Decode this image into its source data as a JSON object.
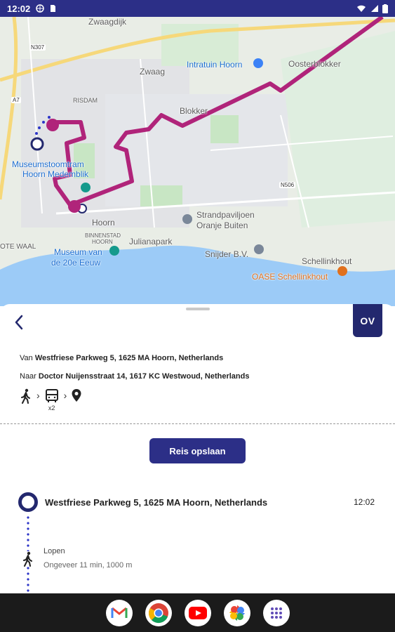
{
  "status_bar": {
    "time": "12:02"
  },
  "map": {
    "labels": {
      "zwaagdijk": "Zwaagdijk",
      "n307": "N307",
      "zwaag": "Zwaag",
      "intratuin": "Intratuin Hoorn",
      "oosterblokker": "Oosterblokker",
      "a7": "A7",
      "risdam": "RISDAM",
      "blokker": "Blokker",
      "museumstoomtram": "Museumstoomtram",
      "hoorn_medemblik": "Hoorn Medemblik",
      "n506": "N506",
      "strandpaviljoen": "Strandpaviljoen",
      "oranje_buiten": "Oranje Buiten",
      "hoorn": "Hoorn",
      "binnenstad": "BINNENSTAD",
      "hoorn_small": "HOORN",
      "julianapark": "Julianapark",
      "snijder": "Snijder B.V.",
      "schellinkhout": "Schellinkhout",
      "ote_waal": "OTE WAAL",
      "museum_van": "Museum van",
      "de_20e_eeuw": "de 20e Eeuw",
      "oase": "OASE Schellinkhout"
    },
    "colors": {
      "route": "#b0247a",
      "water": "#9ccbf7",
      "land": "#e8ece4"
    }
  },
  "sheet": {
    "ov_label": "OV",
    "from_prefix": "Van ",
    "from_address": "Westfriese Parkweg 5, 1625 MA Hoorn, Netherlands",
    "to_prefix": "Naar ",
    "to_address": "Doctor Nuijensstraat 14, 1617 KC Westwoud, Netherlands",
    "modes": [
      "walk-icon",
      "bus-icon",
      "location-pin-icon"
    ],
    "bus_count": "x2",
    "save_label": "Reis opslaan"
  },
  "itinerary": {
    "stop_name": "Westfriese Parkweg 5, 1625 MA Hoorn, Netherlands",
    "stop_time": "12:02",
    "walk_label": "Lopen",
    "walk_detail": "Ongeveer 11 min, 1000 m"
  },
  "dock_apps": [
    "gmail-icon",
    "chrome-icon",
    "youtube-icon",
    "photos-icon",
    "apps-icon"
  ],
  "accent_color": "#2c2f87"
}
